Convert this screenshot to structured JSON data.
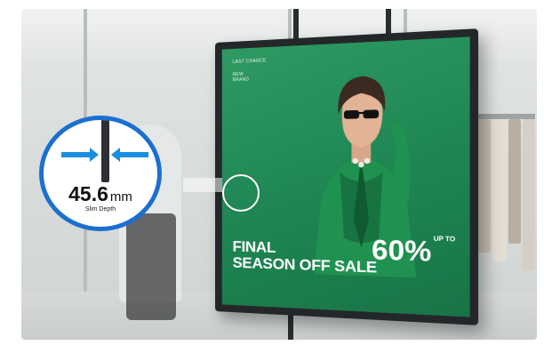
{
  "display": {
    "small_text_1": "LAST CHANCE",
    "small_text_2": "NEW",
    "small_text_3": "BRAND",
    "headline_line1": "FINAL",
    "headline_line2": "SEASON OFF SALE",
    "discount": "60",
    "discount_suffix": "%",
    "discount_small": "UP TO"
  },
  "callout": {
    "value": "45.6",
    "unit": "mm",
    "caption": "Slim Depth",
    "arrow_color": "#1a8fe0",
    "ring_color": "#1b6fd1"
  },
  "colors": {
    "screen_green": "#1e8552",
    "bezel": "#24272a"
  }
}
